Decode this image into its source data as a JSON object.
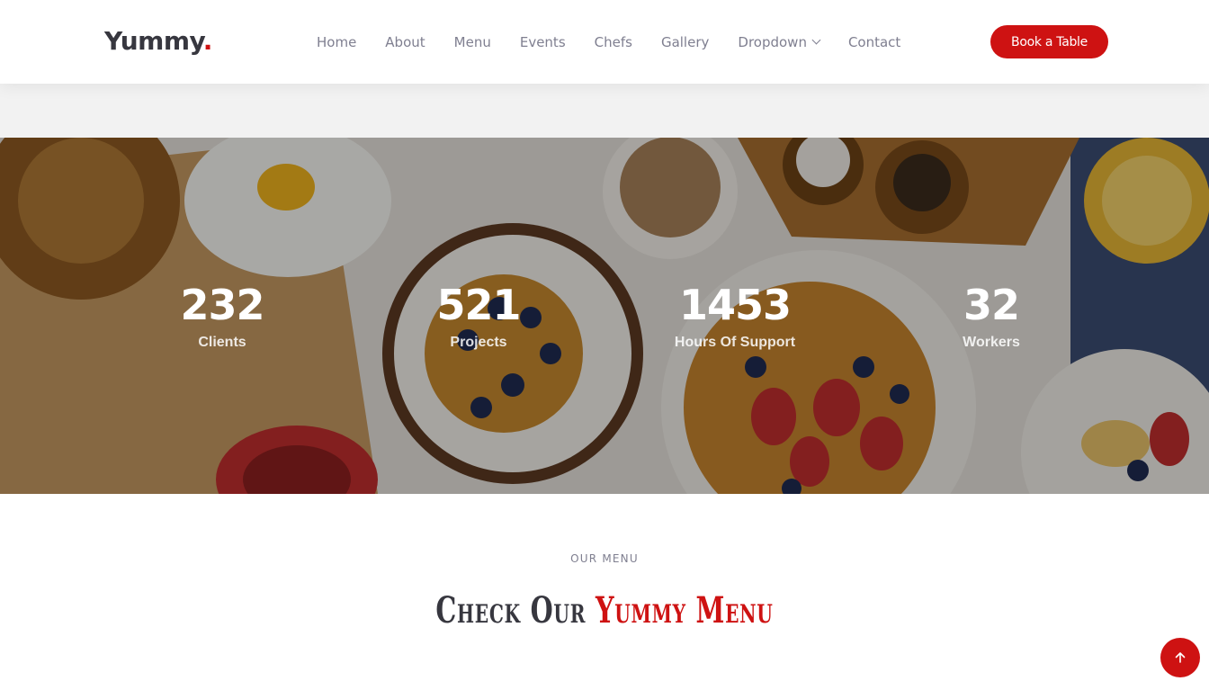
{
  "brand": {
    "name": "Yummy",
    "dot": ".",
    "accent_color": "#ce1212"
  },
  "nav": {
    "items": [
      {
        "label": "Home"
      },
      {
        "label": "About"
      },
      {
        "label": "Menu"
      },
      {
        "label": "Events"
      },
      {
        "label": "Chefs"
      },
      {
        "label": "Gallery"
      },
      {
        "label": "Dropdown",
        "has_dropdown": true
      },
      {
        "label": "Contact"
      }
    ],
    "cta_label": "Book a Table"
  },
  "stats": [
    {
      "number": "232",
      "label": "Clients"
    },
    {
      "number": "521",
      "label": "Projects"
    },
    {
      "number": "1453",
      "label": "Hours Of Support"
    },
    {
      "number": "32",
      "label": "Workers"
    }
  ],
  "menu_section": {
    "subtitle": "OUR MENU",
    "title_prefix": "Check Our",
    "title_accent": "Yummy Menu"
  },
  "icons": {
    "dropdown": "chevron-down-icon",
    "scroll_top": "arrow-up-icon"
  }
}
